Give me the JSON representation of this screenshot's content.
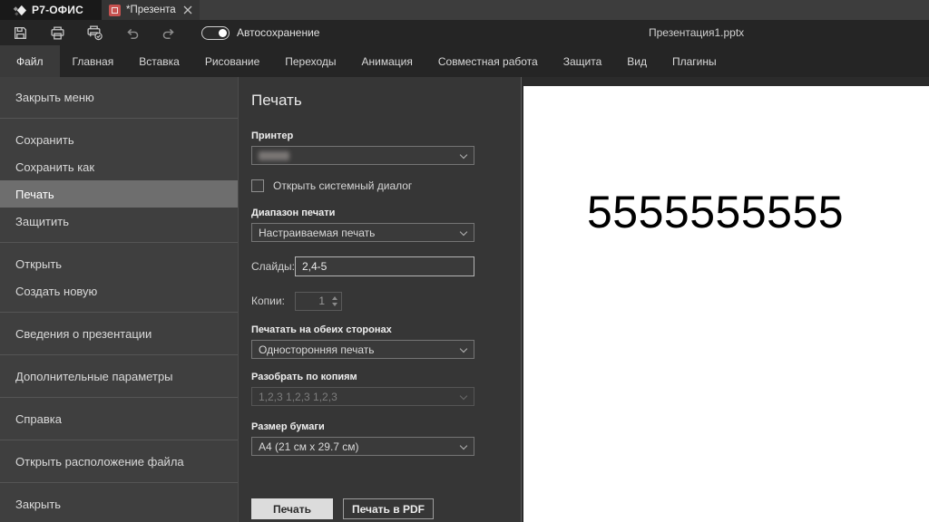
{
  "titlebar": {
    "app_name": "Р7-ОФИС",
    "tab_title": "*Презентация..."
  },
  "toolbar": {
    "autosave_label": "Автосохранение",
    "filename": "Презентация1.pptx",
    "icons": [
      "save-icon",
      "print-icon",
      "quick-print-icon",
      "undo-icon",
      "redo-icon"
    ],
    "autosave_state": "on"
  },
  "menu": {
    "tabs": [
      "Файл",
      "Главная",
      "Вставка",
      "Рисование",
      "Переходы",
      "Анимация",
      "Совместная работа",
      "Защита",
      "Вид",
      "Плагины"
    ],
    "active_tab": "Файл"
  },
  "sidebar": {
    "items": [
      "Закрыть меню",
      "Сохранить",
      "Сохранить как",
      "Печать",
      "Защитить",
      "Открыть",
      "Создать новую",
      "Сведения о презентации",
      "Дополнительные параметры",
      "Справка",
      "Открыть расположение файла",
      "Закрыть"
    ],
    "selected": "Печать"
  },
  "print_panel": {
    "heading": "Печать",
    "printer_label": "Принтер",
    "system_dialog_label": "Открыть системный диалог",
    "system_dialog_checked": false,
    "range_label": "Диапазон печати",
    "range_value": "Настраиваемая печать",
    "slides_label": "Слайды:",
    "slides_value": "2,4-5",
    "copies_label": "Копии:",
    "copies_value": "1",
    "both_sides_label": "Печатать на обеих сторонах",
    "both_sides_value": "Односторонняя печать",
    "collate_label": "Разобрать по копиям",
    "collate_value": "1,2,3 1,2,3 1,2,3",
    "collate_disabled": true,
    "paper_label": "Размер бумаги",
    "paper_value": "A4 (21 см x 29.7 см)",
    "print_button": "Печать",
    "print_pdf_button": "Печать в PDF"
  },
  "preview": {
    "slide_text": "5555555555"
  },
  "colors": {
    "accent_red": "#c75250",
    "sidebar_bg": "#3f3f3f",
    "panel_bg": "#363636",
    "selected_item_bg": "#6e6e6e",
    "titlebar_bg": "#3d3d3d",
    "toolbar_bg": "#252525"
  }
}
